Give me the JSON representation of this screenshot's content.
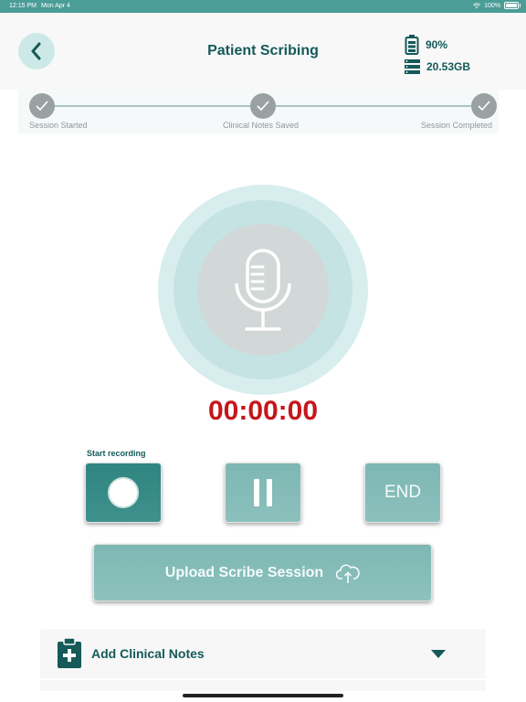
{
  "status_bar": {
    "time": "12:15 PM",
    "date": "Mon Apr 4",
    "battery": "100%"
  },
  "header": {
    "title": "Patient Scribing",
    "battery_level": "90%",
    "storage": "20.53GB"
  },
  "steps": [
    {
      "label": "Session Started",
      "completed": true
    },
    {
      "label": "Clinical Notes Saved",
      "completed": true
    },
    {
      "label": "Session Completed",
      "completed": true
    }
  ],
  "timer": "00:00:00",
  "controls": {
    "record_label": "Start recording",
    "end_label": "END"
  },
  "upload": {
    "label": "Upload Scribe Session"
  },
  "notes": {
    "label": "Add Clinical Notes"
  },
  "colors": {
    "accent": "#145a59",
    "timer": "#c4161c",
    "button": "#8cc0bd",
    "record": "#2f8581"
  }
}
